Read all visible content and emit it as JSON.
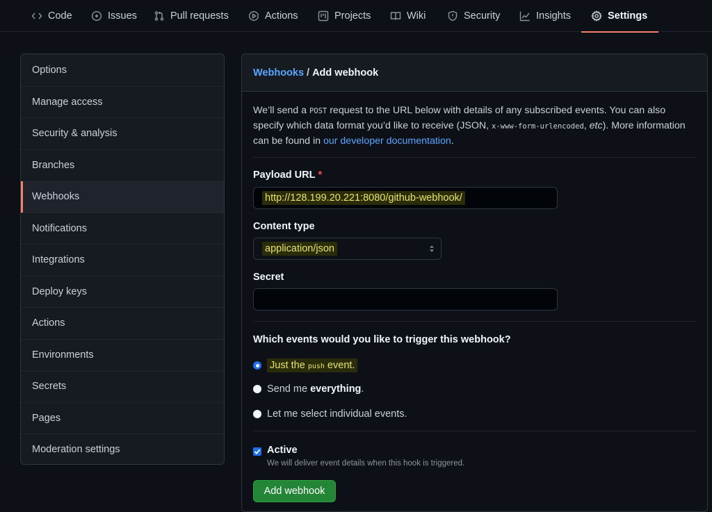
{
  "tabs": [
    {
      "label": "Code",
      "icon": "code-icon"
    },
    {
      "label": "Issues",
      "icon": "issue-icon"
    },
    {
      "label": "Pull requests",
      "icon": "pull-request-icon"
    },
    {
      "label": "Actions",
      "icon": "play-icon"
    },
    {
      "label": "Projects",
      "icon": "project-icon"
    },
    {
      "label": "Wiki",
      "icon": "book-icon"
    },
    {
      "label": "Security",
      "icon": "shield-icon"
    },
    {
      "label": "Insights",
      "icon": "graph-icon"
    },
    {
      "label": "Settings",
      "icon": "gear-icon",
      "active": true
    }
  ],
  "sidebar": {
    "items": [
      {
        "label": "Options"
      },
      {
        "label": "Manage access"
      },
      {
        "label": "Security & analysis"
      },
      {
        "label": "Branches"
      },
      {
        "label": "Webhooks",
        "selected": true
      },
      {
        "label": "Notifications"
      },
      {
        "label": "Integrations"
      },
      {
        "label": "Deploy keys"
      },
      {
        "label": "Actions"
      },
      {
        "label": "Environments"
      },
      {
        "label": "Secrets"
      },
      {
        "label": "Pages"
      },
      {
        "label": "Moderation settings"
      }
    ]
  },
  "header": {
    "crumb_link": "Webhooks",
    "crumb_sep": "/",
    "crumb_current": "Add webhook"
  },
  "intro": {
    "p1": "We’ll send a ",
    "code1": "POST",
    "p2": " request to the URL below with details of any subscribed events. You can also specify which data format you’d like to receive (JSON, ",
    "code2": "x-www-form-urlencoded",
    "p3": ", ",
    "etc": "etc",
    "p4": "). More information can be found in ",
    "link": "our developer documentation",
    "p5": "."
  },
  "form": {
    "payload_label": "Payload URL",
    "required_mark": "*",
    "payload_value": "http://128.199.20.221:8080/github-webhook/",
    "content_type_label": "Content type",
    "content_type_value": "application/json",
    "secret_label": "Secret",
    "secret_value": "",
    "events_question": "Which events would you like to trigger this webhook?",
    "opt1_a": "Just the ",
    "opt1_code": "push",
    "opt1_b": " event.",
    "opt2_a": "Send me ",
    "opt2_b": "everything",
    "opt2_c": ".",
    "opt3": "Let me select individual events.",
    "active_label": "Active",
    "active_note": "We will deliver event details when this hook is triggered.",
    "submit": "Add webhook"
  },
  "colors": {
    "accent_underline": "#f78166",
    "link": "#58a6ff",
    "button": "#238636",
    "highlight": "#e6e36a"
  }
}
